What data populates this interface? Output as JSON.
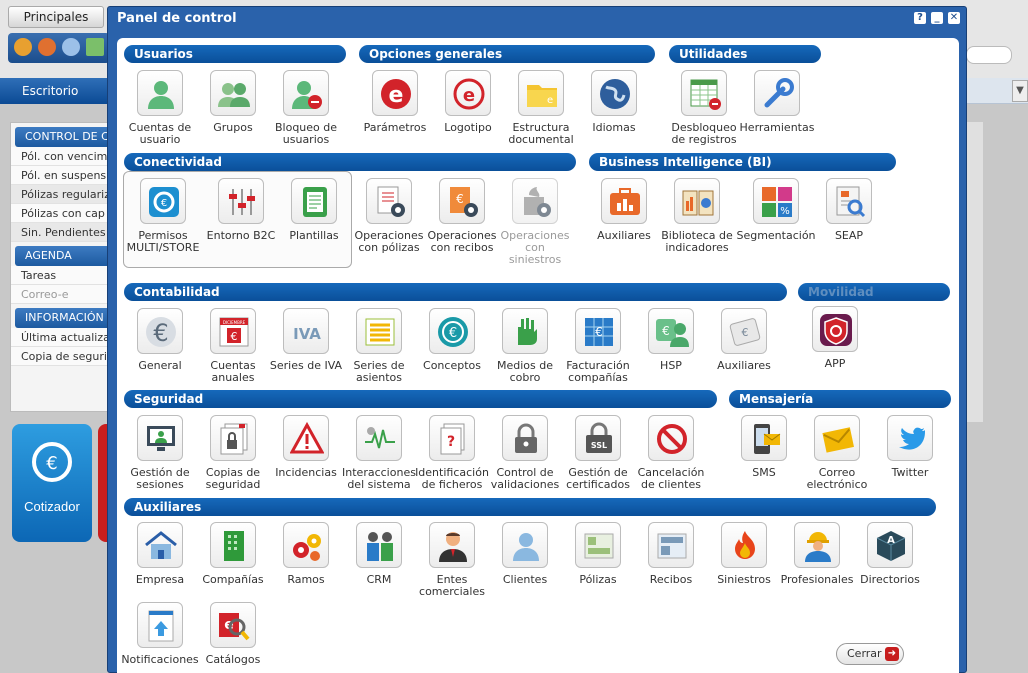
{
  "background": {
    "tab_label": "Principales",
    "nav_tab": "Escritorio",
    "sidebar": {
      "header1": "CONTROL DE C",
      "rows1": [
        "Pól. con vencim",
        "Pól. en suspens",
        "Pólizas regulariz",
        "Pólizas con cap",
        "Sin. Pendientes"
      ],
      "header2": "AGENDA",
      "rows2": [
        "Tareas",
        "Correo-e"
      ],
      "header3": "INFORMACIÓN",
      "rows3": [
        "Última actualiza",
        "Copia de seguri"
      ]
    },
    "cotizador_label": "Cotizador"
  },
  "dialog": {
    "title": "Panel de control",
    "help": "?",
    "minimize": "_",
    "close": "✕",
    "close_button": "Cerrar"
  },
  "sections": {
    "usuarios": "Usuarios",
    "opciones": "Opciones generales",
    "utilidades": "Utilidades",
    "conectividad": "Conectividad",
    "bi": "Business Intelligence (BI)",
    "contabilidad": "Contabilidad",
    "movilidad": "Movilidad",
    "seguridad": "Seguridad",
    "mensajeria": "Mensajería",
    "auxiliares": "Auxiliares"
  },
  "items": {
    "usuarios": [
      "Cuentas de\nusuario",
      "Grupos",
      "Bloqueo de\nusuarios"
    ],
    "opciones": [
      "Parámetros",
      "Logotipo",
      "Estructura\ndocumental",
      "Idiomas"
    ],
    "utilidades": [
      "Desbloqueo\nde registros",
      "Herramientas"
    ],
    "conectividad": [
      "Permisos\nMULTI/STORE",
      "Entorno B2C",
      "Plantillas",
      "Operaciones\ncon pólizas",
      "Operaciones\ncon recibos",
      "Operaciones\ncon\nsiniestros"
    ],
    "bi": [
      "Auxiliares",
      "Biblioteca de\nindicadores",
      "Segmentación",
      "SEAP"
    ],
    "contabilidad": [
      "General",
      "Cuentas\nanuales",
      "Series de IVA",
      "Series de\nasientos",
      "Conceptos",
      "Medios de\ncobro",
      "Facturación\ncompañías",
      "HSP",
      "Auxiliares"
    ],
    "movilidad": [
      "APP"
    ],
    "seguridad": [
      "Gestión de\nsesiones",
      "Copias de\nseguridad",
      "Incidencias",
      "Interacciones\ndel sistema",
      "Identificación\nde ficheros",
      "Control de\nvalidaciones",
      "Gestión de\ncertificados",
      "Cancelación\nde clientes"
    ],
    "mensajeria": [
      "SMS",
      "Correo\nelectrónico",
      "Twitter"
    ],
    "auxiliares": [
      "Empresa",
      "Compañías",
      "Ramos",
      "CRM",
      "Entes\ncomerciales",
      "Clientes",
      "Pólizas",
      "Recibos",
      "Siniestros",
      "Profesionales",
      "Directorios",
      "Notificaciones",
      "Catálogos"
    ]
  },
  "icon_text": {
    "iva": "IVA",
    "ssl": "SSL",
    "calendar": "DICIEMBRE",
    "letter_a": "A",
    "percent": "%"
  },
  "colors": {
    "title_bar": "#2a62ab",
    "section": "#0a4f99",
    "accent_red": "#d2232a"
  }
}
